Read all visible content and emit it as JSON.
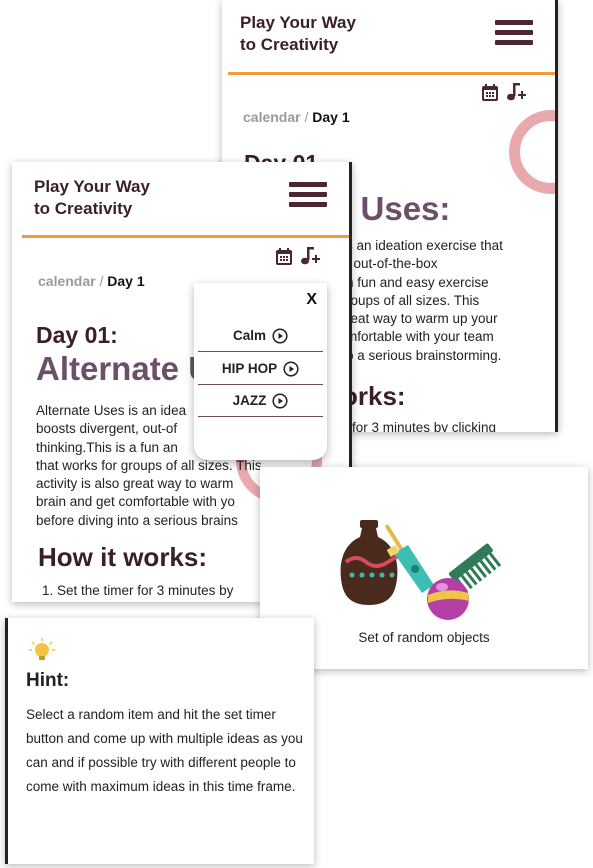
{
  "app": {
    "title": "Play Your Way\nto Creativity"
  },
  "breadcrumb": {
    "link": "calendar",
    "separator": "/",
    "current": "Day 1"
  },
  "back_screen": {
    "day_partial": "Day 01",
    "title_partial": "te Uses:",
    "desc_lines": [
      "s an ideation exercise that",
      ", out-of-the-box",
      "n fun and easy exercise",
      "roups of all sizes. This",
      "reat way to warm up your",
      "mfortable with your team",
      "o a serious brainstorming."
    ],
    "section_partial": "orks:",
    "step_partial": "for 3 minutes by clicking"
  },
  "front_screen": {
    "day": "Day 01:",
    "title": "Alternate U",
    "desc_lines": [
      "Alternate Uses is an idea",
      "boosts divergent, out-of",
      "thinking.This is a fun an",
      "that works for groups of all sizes. This",
      "activity is also great way to warm",
      "brain and get comfortable with yo",
      "before diving into a serious brains"
    ],
    "section": "How it works:",
    "step": "1. Set the timer for 3 minutes by"
  },
  "music_popup": {
    "close": "X",
    "genres": [
      "Calm",
      "HIP HOP",
      "JAZZ"
    ]
  },
  "objects": {
    "caption": "Set of random objects"
  },
  "hint": {
    "title": "Hint:",
    "text": "Select a random item and hit the set timer button and come up with multiple ideas as you can and if possible try with different people to come with maximum ideas in this time frame."
  },
  "icons": {
    "calendar": "calendar-icon",
    "music_add": "music-add-icon",
    "menu": "hamburger-menu-icon",
    "bulb": "lightbulb-icon",
    "play": "play-circle-icon"
  },
  "colors": {
    "accent_orange": "#f39a3e",
    "title_purple": "#6e4f6a",
    "dark_maroon": "#3a1f2b",
    "ring_pink": "#e8a8ad",
    "bulb_yellow": "#f6c244"
  }
}
